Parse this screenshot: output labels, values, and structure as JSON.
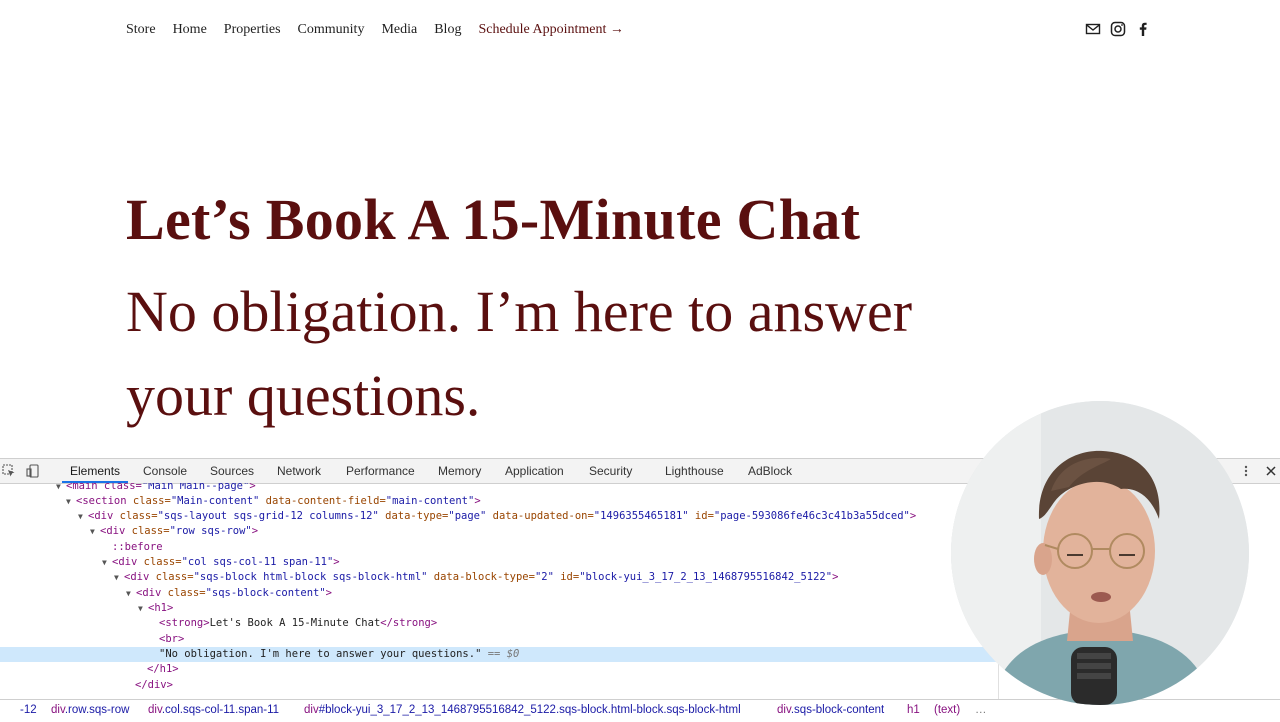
{
  "nav": {
    "items": [
      "Store",
      "Home",
      "Properties",
      "Community",
      "Media",
      "Blog"
    ],
    "cta": "Schedule Appointment →"
  },
  "social": [
    "mail-icon",
    "instagram-icon",
    "facebook-icon"
  ],
  "hero": {
    "title": "Let’s Book A 15-Minute Chat",
    "subtitle": "No obligation. I’m here to answer your questions."
  },
  "colors": {
    "brand": "#5a0f0f",
    "selection": "#cfe8fc",
    "tab_accent": "#1a73e8"
  },
  "devtools": {
    "tabs": [
      "Elements",
      "Console",
      "Sources",
      "Network",
      "Performance",
      "Memory",
      "Application",
      "Security",
      "Lighthouse",
      "AdBlock"
    ],
    "active_tab": "Elements",
    "tree": {
      "r0": {
        "tag": "<main class=",
        "val": "\"Main Main--page\"",
        "end": ">"
      },
      "r1": {
        "tag": "<section",
        "a1": " class=",
        "v1": "\"Main-content\"",
        "a2": " data-content-field=",
        "v2": "\"main-content\"",
        "end": ">"
      },
      "r2": {
        "tag": "<div",
        "a1": " class=",
        "v1": "\"sqs-layout sqs-grid-12 columns-12\"",
        "a2": " data-type=",
        "v2": "\"page\"",
        "a3": " data-updated-on=",
        "v3": "\"1496355465181\"",
        "a4": " id=",
        "v4": "\"page-593086fe46c3c41b3a55dced\"",
        "end": ">"
      },
      "r3": {
        "tag": "<div",
        "a1": " class=",
        "v1": "\"row sqs-row\"",
        "end": ">"
      },
      "r4": {
        "pseudo": "::before"
      },
      "r5": {
        "tag": "<div",
        "a1": " class=",
        "v1": "\"col sqs-col-11 span-11\"",
        "end": ">"
      },
      "r6": {
        "tag": "<div",
        "a1": " class=",
        "v1": "\"sqs-block html-block sqs-block-html\"",
        "a2": " data-block-type=",
        "v2": "\"2\"",
        "a3": " id=",
        "v3": "\"block-yui_3_17_2_13_1468795516842_5122\"",
        "end": ">"
      },
      "r7": {
        "tag": "<div",
        "a1": " class=",
        "v1": "\"sqs-block-content\"",
        "end": ">"
      },
      "r8": {
        "tag": "<h1>"
      },
      "r9": {
        "open": "<strong>",
        "text": "Let's Book A 15-Minute Chat",
        "close": "</strong>"
      },
      "r10": {
        "tag": "<br>"
      },
      "r11": {
        "text": "\"No obligation. I'm here to answer your questions.\"",
        "meta": " == $0"
      },
      "r12": {
        "tag": "</h1>"
      },
      "r13": {
        "tag": "</div>"
      }
    },
    "breadcrumbs": [
      {
        "tag": "",
        "cls": "-12"
      },
      {
        "tag": "div",
        "cls": ".row.sqs-row"
      },
      {
        "tag": "div",
        "cls": ".col.sqs-col-11.span-11"
      },
      {
        "tag": "div",
        "cls": "#block-yui_3_17_2_13_1468795516842_5122.sqs-block.html-block.sqs-block-html"
      },
      {
        "tag": "div",
        "cls": ".sqs-block-content"
      },
      {
        "tag": "h1",
        "cls": ""
      },
      {
        "tag": "(text)",
        "cls": ""
      },
      {
        "tag": "…",
        "cls": ""
      }
    ]
  }
}
